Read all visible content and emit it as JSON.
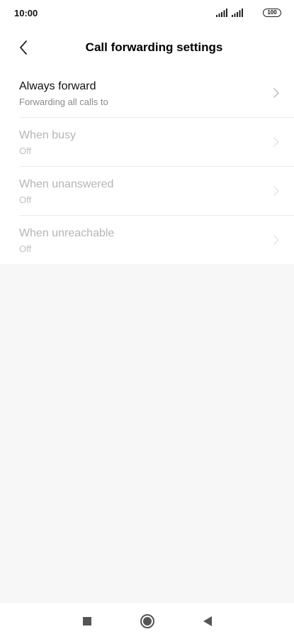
{
  "status_bar": {
    "time": "10:00",
    "battery": "100",
    "icons": [
      "signal-icon",
      "signal-icon",
      "battery-icon"
    ]
  },
  "header": {
    "title": "Call forwarding settings",
    "back_icon": "chevron-left-icon"
  },
  "list": {
    "items": [
      {
        "title": "Always forward",
        "subtitle": "Forwarding all calls to",
        "enabled": true
      },
      {
        "title": "When busy",
        "subtitle": "Off",
        "enabled": false
      },
      {
        "title": "When unanswered",
        "subtitle": "Off",
        "enabled": false
      },
      {
        "title": "When unreachable",
        "subtitle": "Off",
        "enabled": false
      }
    ],
    "chevron_icon": "chevron-right-icon"
  },
  "nav_bar": {
    "buttons": [
      "recents-square-icon",
      "home-circle-icon",
      "back-triangle-icon"
    ]
  },
  "colors": {
    "background": "#f7f7f7",
    "surface": "#ffffff",
    "text_primary": "#111111",
    "text_secondary": "#8a8a8a",
    "text_disabled": "#b5b5b5"
  }
}
